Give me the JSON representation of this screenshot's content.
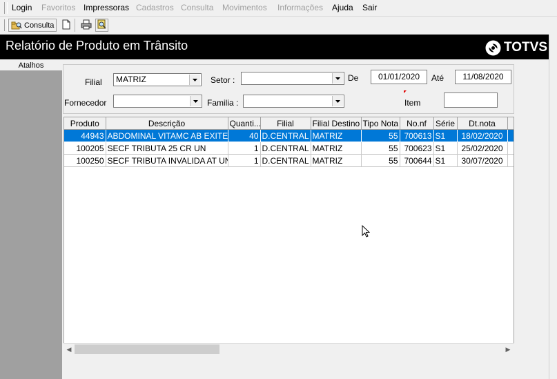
{
  "menu": {
    "items": [
      {
        "label": "Login",
        "enabled": true
      },
      {
        "label": "Favoritos",
        "enabled": false
      },
      {
        "label": "Impressoras",
        "enabled": true
      },
      {
        "label": "Cadastros",
        "enabled": false
      },
      {
        "label": "Consulta",
        "enabled": false
      },
      {
        "label": "Movimentos",
        "enabled": false
      },
      {
        "label": "Informações",
        "enabled": false
      },
      {
        "label": "Ajuda",
        "enabled": true
      },
      {
        "label": "Sair",
        "enabled": true
      }
    ]
  },
  "toolbar": {
    "consulta_label": "Consulta"
  },
  "window": {
    "title": "Relatório de Produto em Trânsito"
  },
  "brand": {
    "logo_text": "TOTVS"
  },
  "sidebar": {
    "header": "Atalhos"
  },
  "filters": {
    "filial_label": "Filial",
    "filial_value": "MATRIZ",
    "setor_label": "Setor :",
    "setor_value": "",
    "de_label": "De",
    "de_value": "01/01/2020",
    "ate_label": "Até",
    "ate_value": "11/08/2020",
    "fornecedor_label": "Fornecedor",
    "fornecedor_value": "",
    "familia_label": "Familia :",
    "familia_value": "",
    "item_label": "Item",
    "item_value": ""
  },
  "grid": {
    "columns": [
      "Produto",
      "Descrição",
      "Quanti...",
      "Filial",
      "Filial Destino",
      "Tipo Nota",
      "No.nf",
      "Série",
      "Dt.nota"
    ],
    "rows": [
      [
        "44943",
        "ABDOMINAL VITAMC AB EXITE CJ",
        "40",
        "D.CENTRAL",
        "MATRIZ",
        "55",
        "700613",
        "S1",
        "18/02/2020"
      ],
      [
        "100205",
        "SECF TRIBUTA 25 CR  UN",
        "1",
        "D.CENTRAL",
        "MATRIZ",
        "55",
        "700623",
        "S1",
        "25/02/2020"
      ],
      [
        "100250",
        "SECF TRIBUTA INVALIDA AT  UN",
        "1",
        "D.CENTRAL",
        "MATRIZ",
        "55",
        "700644",
        "S1",
        "30/07/2020"
      ]
    ],
    "selected_row": 0
  },
  "colors": {
    "accent": "#0078d7",
    "titlebar": "#000000",
    "sidebar": "#a0a0a0"
  }
}
